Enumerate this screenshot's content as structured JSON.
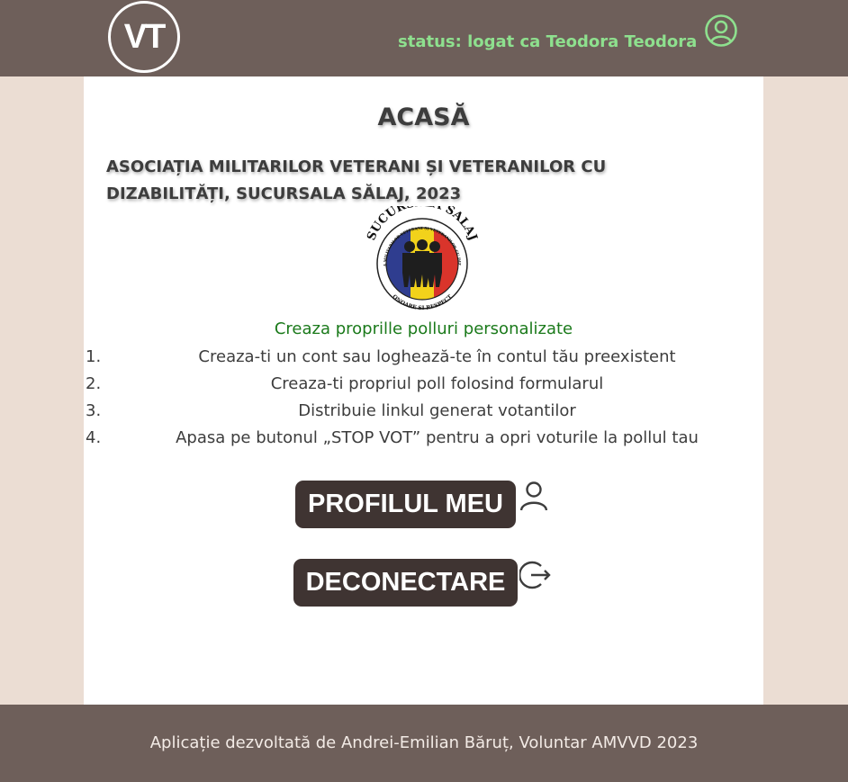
{
  "header": {
    "logo_text": "VT",
    "status_text": "status: logat ca Teodora Teodora",
    "status_icon": "user-circle-icon",
    "status_color": "#8ee08e",
    "background": "#6e5f5a"
  },
  "main": {
    "title": "ACASĂ",
    "org_name": "ASOCIAȚIA MILITARILOR VETERANI ȘI VETERANILOR CU DIZABILITĂȚI, SUCURSALA SĂLAJ, 2023",
    "emblem": {
      "top_text": "SUCURSALA SALAJ",
      "ring_text": "ASOCIATIA MILITARILOR VETERANI SI VETERANILOR CU DIZABILITATI",
      "bottom_text": "ONOARE SI RESPECT"
    },
    "subtitle": "Creaza proprille polluri personalizate",
    "steps": [
      {
        "num": "1.",
        "text": "Creaza-ti un cont sau loghează-te în contul tău preexistent"
      },
      {
        "num": "2.",
        "text": "Creaza-ti propriul poll folosind formularul"
      },
      {
        "num": "3.",
        "text": "Distribuie linkul generat votantilor"
      },
      {
        "num": "4.",
        "text": "Apasa pe butonul „STOP VOT” pentru a opri voturile la pollul tau"
      }
    ],
    "buttons": {
      "profile_label": "PROFILUL MEU",
      "profile_icon": "user-icon",
      "logout_label": "DECONECTARE",
      "logout_icon": "logout-icon"
    }
  },
  "footer": {
    "text": "Aplicație dezvoltată de Andrei-Emilian Băruț, Voluntar AMVVD 2023"
  },
  "colors": {
    "accent_green": "#1b7a1b",
    "button_bg": "#3f3432",
    "side_bg": "#ebddd3"
  }
}
